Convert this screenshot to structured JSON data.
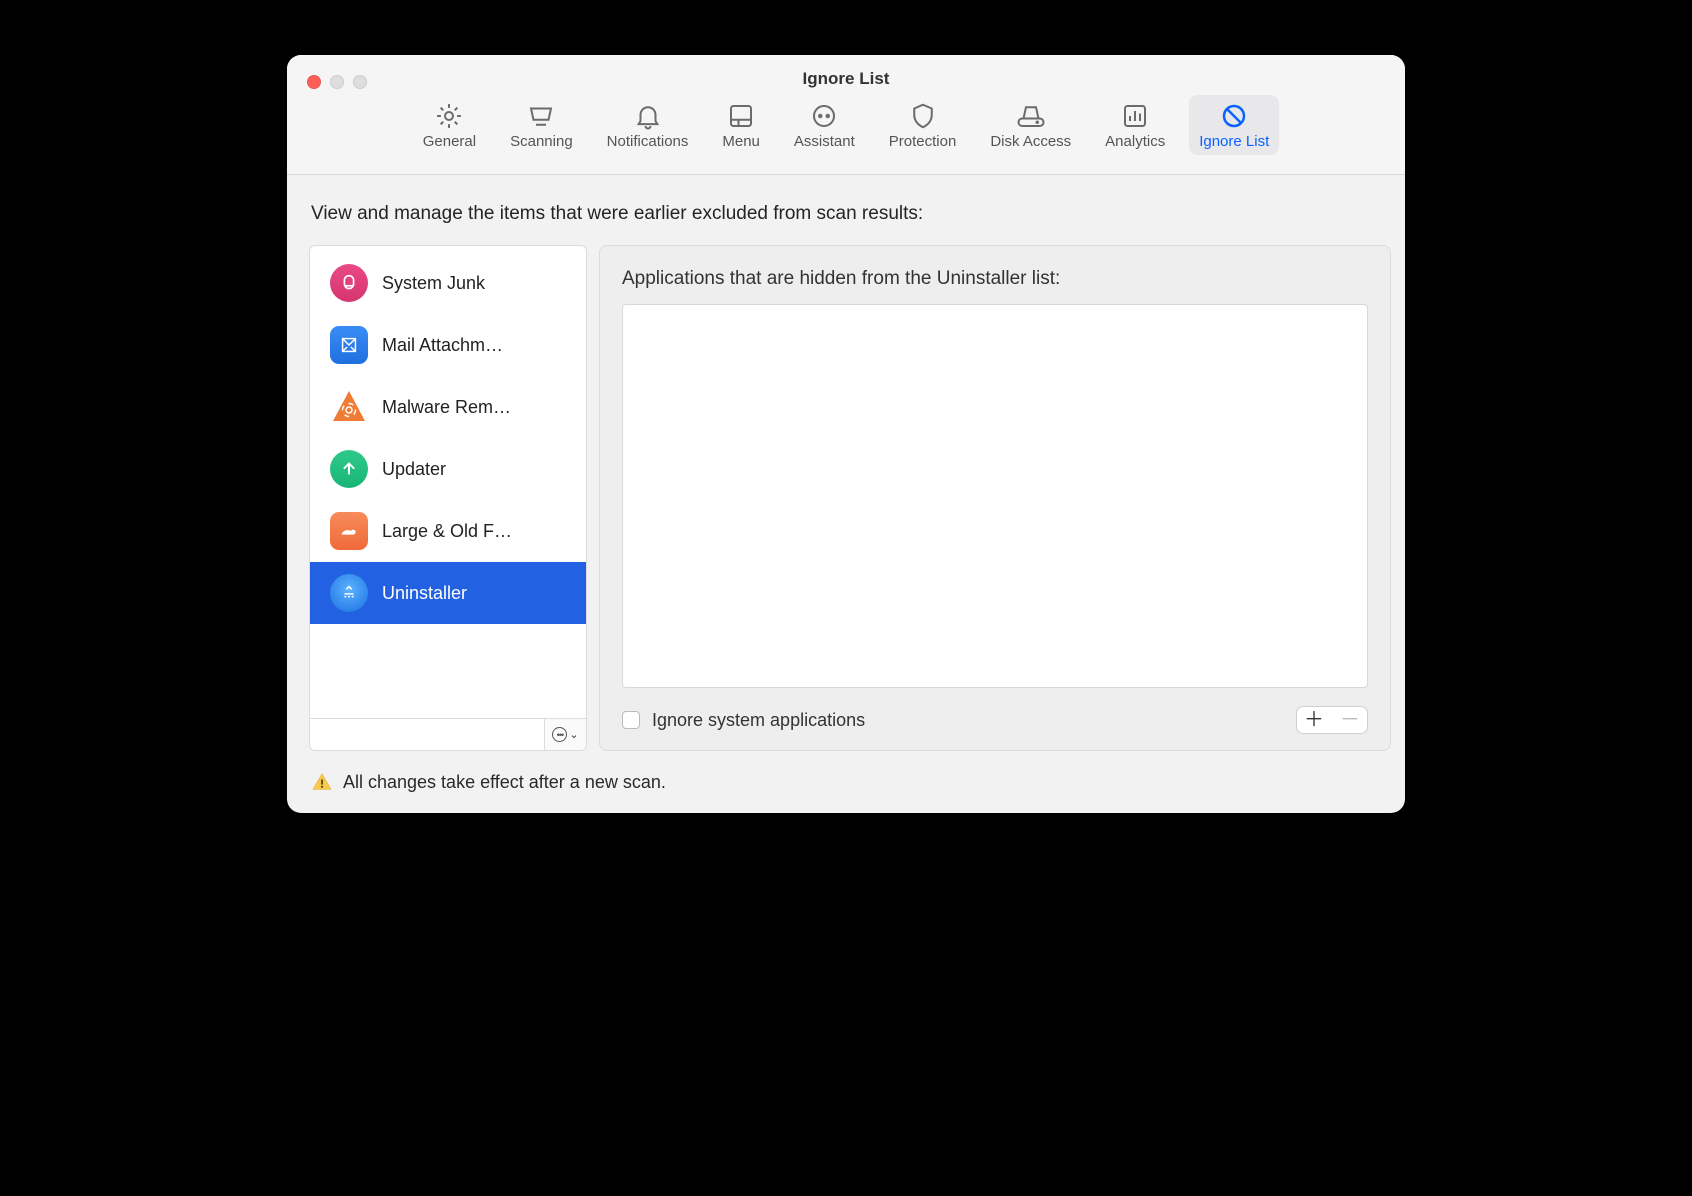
{
  "window_title": "Ignore List",
  "tabs": [
    {
      "id": "general",
      "label": "General"
    },
    {
      "id": "scanning",
      "label": "Scanning"
    },
    {
      "id": "notifications",
      "label": "Notifications"
    },
    {
      "id": "menu",
      "label": "Menu"
    },
    {
      "id": "assistant",
      "label": "Assistant"
    },
    {
      "id": "protection",
      "label": "Protection"
    },
    {
      "id": "disk-access",
      "label": "Disk Access"
    },
    {
      "id": "analytics",
      "label": "Analytics"
    },
    {
      "id": "ignore-list",
      "label": "Ignore List"
    }
  ],
  "active_tab": "ignore-list",
  "description": "View and manage the items that were earlier excluded from scan results:",
  "sidebar": {
    "items": [
      {
        "id": "system-junk",
        "label": "System Junk",
        "color1": "#e94a86",
        "color2": "#d6356e",
        "icon": "mouse"
      },
      {
        "id": "mail-attachments",
        "label": "Mail Attachm…",
        "color1": "#3a8cf5",
        "color2": "#1f6fe0",
        "icon": "stamp"
      },
      {
        "id": "malware-removal",
        "label": "Malware Rem…",
        "color1": "#f58b3b",
        "color2": "#e76f20",
        "icon": "biohazard"
      },
      {
        "id": "updater",
        "label": "Updater",
        "color1": "#2fc98c",
        "color2": "#19b577",
        "icon": "arrow-up"
      },
      {
        "id": "large-old",
        "label": "Large & Old F…",
        "color1": "#f88b5a",
        "color2": "#f06a3a",
        "icon": "whale"
      },
      {
        "id": "uninstaller",
        "label": "Uninstaller",
        "color1": "#3897f7",
        "color2": "#1a6fe0",
        "icon": "uninstall"
      }
    ],
    "selected": "uninstaller",
    "filter_value": ""
  },
  "detail": {
    "title": "Applications that are hidden from the Uninstaller list:",
    "checkbox_label": "Ignore system applications",
    "checkbox_checked": false
  },
  "footer_note": "All changes take effect after a new scan.",
  "colors": {
    "accent": "#0a63ff",
    "selection": "#2261e2"
  }
}
